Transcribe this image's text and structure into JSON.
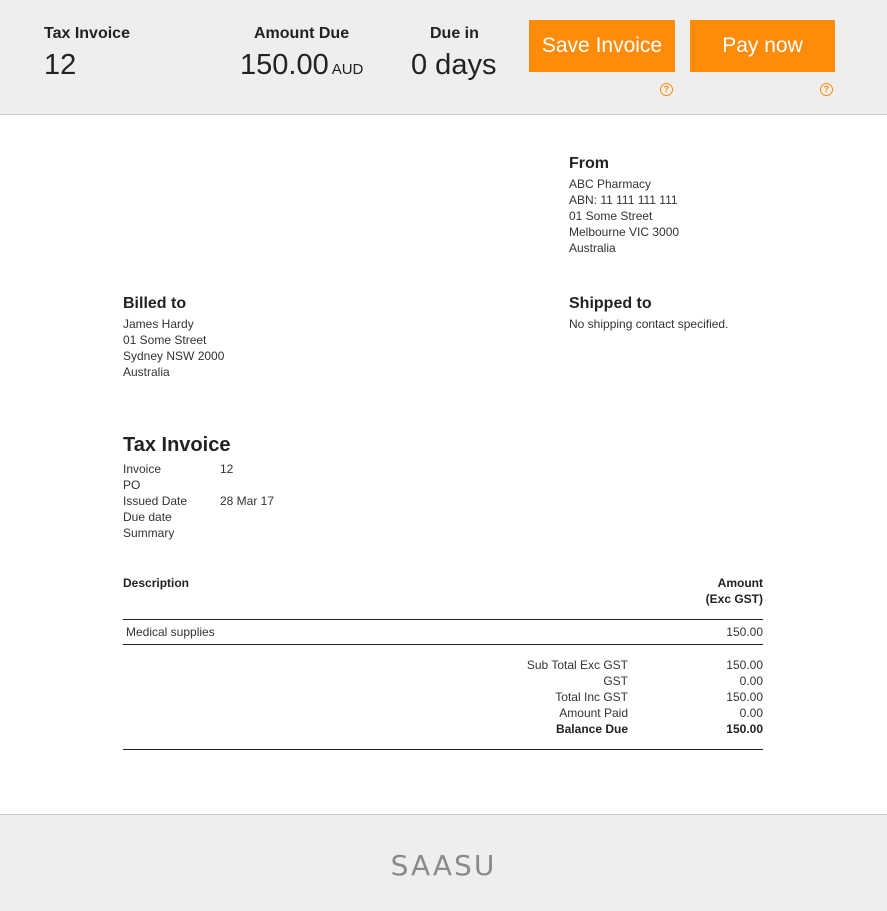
{
  "header": {
    "invoice_label": "Tax Invoice",
    "invoice_number": "12",
    "amount_label": "Amount Due",
    "amount_value": "150.00",
    "amount_currency": "AUD",
    "due_label": "Due in",
    "due_value": "0 days",
    "save_button": "Save Invoice",
    "pay_button": "Pay now",
    "help_glyph": "?"
  },
  "from": {
    "title": "From",
    "lines": [
      "ABC Pharmacy",
      "ABN: 11 111 111 111",
      "01 Some Street",
      "Melbourne  VIC 3000",
      "Australia"
    ]
  },
  "billed_to": {
    "title": "Billed to",
    "lines": [
      "James Hardy",
      "01 Some Street",
      "Sydney NSW 2000",
      "Australia"
    ]
  },
  "shipped_to": {
    "title": "Shipped to",
    "lines": [
      "No shipping contact specified."
    ]
  },
  "document": {
    "title": "Tax Invoice",
    "fields": [
      {
        "label": "Invoice",
        "value": "12"
      },
      {
        "label": "PO",
        "value": ""
      },
      {
        "label": "Issued Date",
        "value": "28 Mar 17"
      },
      {
        "label": "Due date",
        "value": ""
      },
      {
        "label": "Summary",
        "value": ""
      }
    ]
  },
  "table": {
    "col_description": "Description",
    "col_amount_line1": "Amount",
    "col_amount_line2": "(Exc GST)",
    "rows": [
      {
        "description": "Medical supplies",
        "amount": "150.00"
      }
    ]
  },
  "totals": [
    {
      "label": "Sub Total Exc GST",
      "value": "150.00"
    },
    {
      "label": "GST",
      "value": "0.00"
    },
    {
      "label": "Total Inc GST",
      "value": "150.00"
    },
    {
      "label": "Amount Paid",
      "value": "0.00"
    },
    {
      "label": "Balance Due",
      "value": "150.00"
    }
  ],
  "footer": {
    "logo_text": "SAASU"
  },
  "colors": {
    "accent": "#ff8b0a",
    "header_bg": "#eeeeee",
    "logo": "#8a8a8a"
  }
}
